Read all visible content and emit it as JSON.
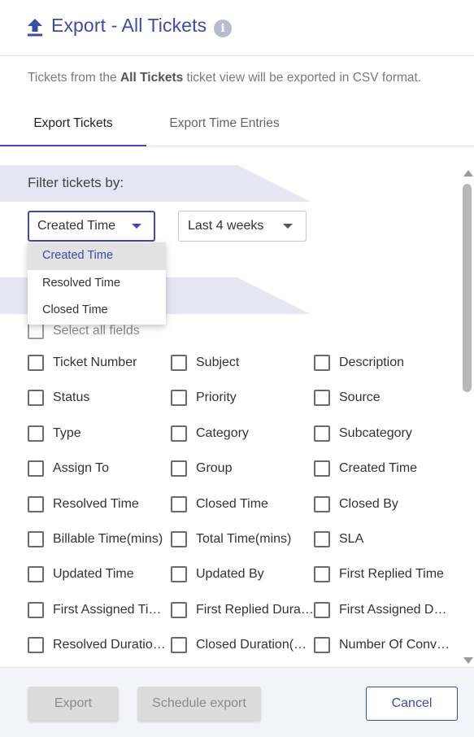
{
  "header": {
    "title": "Export - All Tickets",
    "upload_icon": "upload-icon",
    "info_icon_glyph": "i"
  },
  "description": {
    "prefix": "Tickets from the ",
    "view_name": "All Tickets",
    "suffix": " ticket view will be exported in CSV format."
  },
  "tabs": [
    {
      "label": "Export Tickets",
      "active": true
    },
    {
      "label": "Export Time Entries",
      "active": false
    }
  ],
  "filter": {
    "heading": "Filter tickets by:",
    "field_select": {
      "value": "Created Time",
      "options": [
        "Created Time",
        "Resolved Time",
        "Closed Time"
      ],
      "selected_index": 0,
      "open": true
    },
    "range_select": {
      "value": "Last 4 weeks"
    }
  },
  "fields": {
    "select_all_label": "Select all fields",
    "items": [
      "Ticket Number",
      "Subject",
      "Description",
      "Status",
      "Priority",
      "Source",
      "Type",
      "Category",
      "Subcategory",
      "Assign To",
      "Group",
      "Created Time",
      "Resolved Time",
      "Closed Time",
      "Closed By",
      "Billable Time(mins)",
      "Total Time(mins)",
      "SLA",
      "Updated Time",
      "Updated By",
      "First Replied Time",
      "First Assigned Ti…",
      "First Replied Dura…",
      "First Assigned Du…",
      "Resolved Duratio…",
      "Closed Duration(…",
      "Number Of Conve…"
    ]
  },
  "footer": {
    "export_label": "Export",
    "schedule_label": "Schedule export",
    "cancel_label": "Cancel"
  },
  "colors": {
    "accent": "#3d4ba8",
    "banner": "#e5e5f3",
    "footer_bg": "#f3f4f9"
  }
}
